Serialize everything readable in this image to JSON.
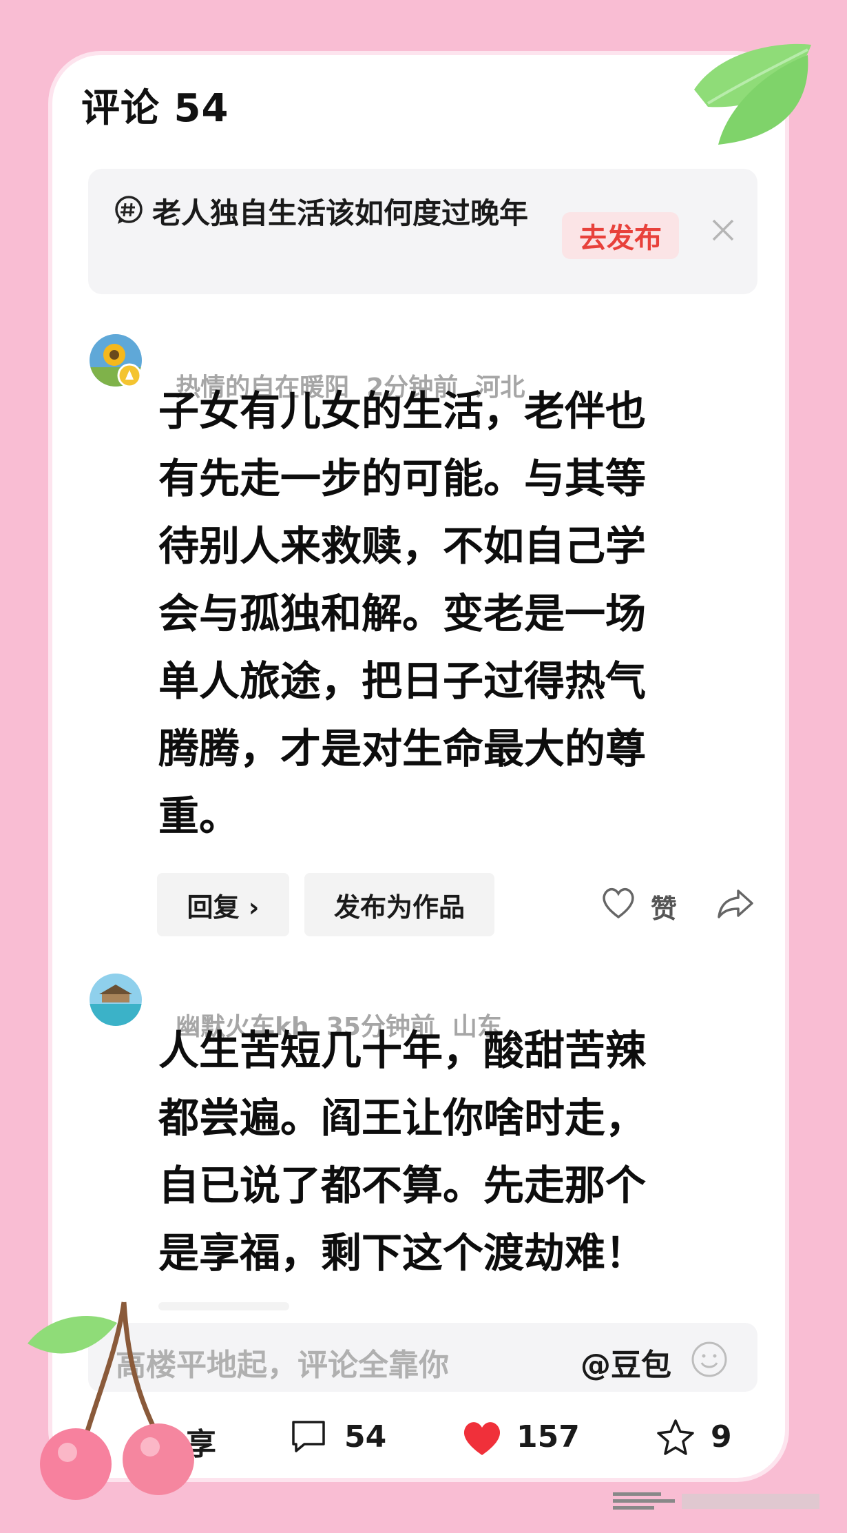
{
  "header": {
    "title": "评论 54"
  },
  "topic": {
    "text": "老人独自生活该如何度过晚年",
    "publish_label": "去发布"
  },
  "comments": [
    {
      "username": "热情的自在暖阳",
      "time": "2分钟前",
      "location": "河北",
      "lines": [
        "子女有儿女的生活，老伴也",
        "有先走一步的可能。与其等",
        "待别人来救赎，不如自己学",
        "会与孤独和解。变老是一场",
        "单人旅途，把日子过得热气",
        "腾腾，才是对生命最大的尊",
        "重。"
      ],
      "reply_label": "回复 ›",
      "publish_work_label": "发布为作品",
      "like_label": "赞"
    },
    {
      "username": "幽默火车kh",
      "time": "35分钟前",
      "location": "山东",
      "lines": [
        "人生苦短几十年，酸甜苦辣",
        "都尝遍。阎王让你啥时走，",
        "自已说了都不算。先走那个",
        "是享福，剩下这个渡劫难！"
      ]
    }
  ],
  "input": {
    "placeholder": "高楼平地起，评论全靠你",
    "mention": "@豆包"
  },
  "bottom_bar": {
    "share_label": "享",
    "comment_count": "54",
    "like_count": "157",
    "favorite_count": "9"
  },
  "colors": {
    "background": "#f9bdd3",
    "accent_red": "#e8413b",
    "heart": "#f0303a"
  }
}
